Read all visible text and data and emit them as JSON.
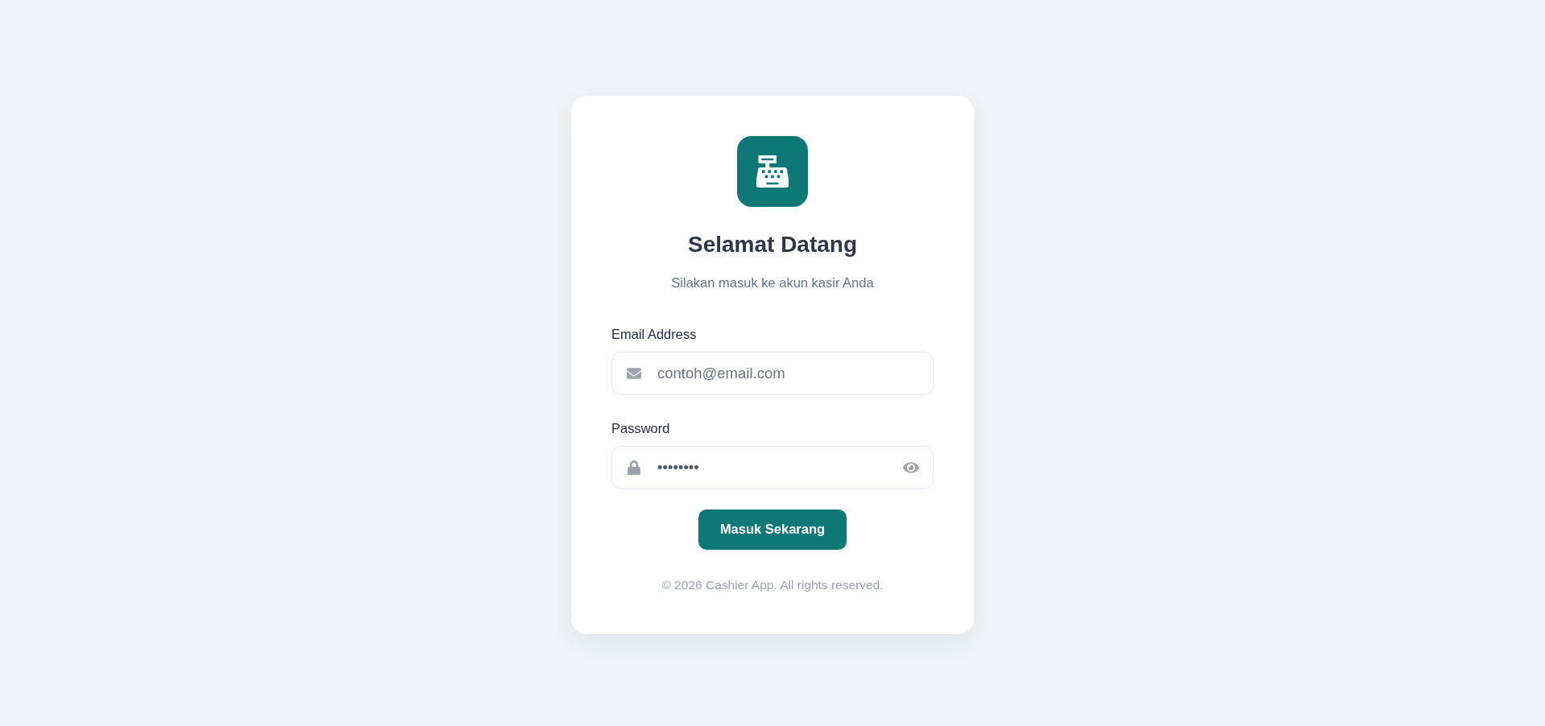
{
  "header": {
    "title": "Selamat Datang",
    "subtitle": "Silakan masuk ke akun kasir Anda"
  },
  "fields": [
    {
      "kind": "email",
      "label": "Email Address",
      "placeholder": "contoh@email.com"
    },
    {
      "kind": "password",
      "label": "Password",
      "value": "••••••••"
    }
  ],
  "submit_button": {
    "label": "Masuk Sekarang"
  },
  "footer": "© 2026 Cashier App. All rights reserved."
}
